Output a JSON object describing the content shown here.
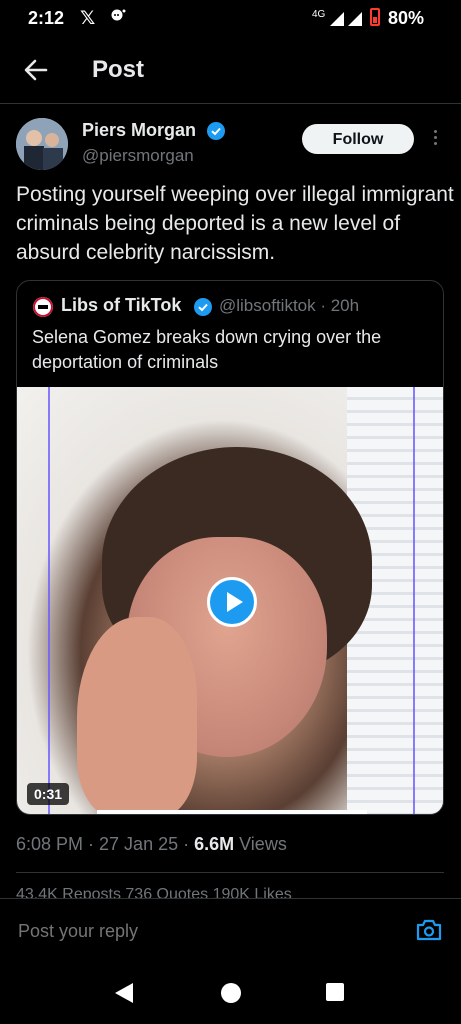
{
  "status_bar": {
    "time": "2:12",
    "x_logo": "𝕏",
    "network": "4G",
    "battery": "80%"
  },
  "header": {
    "title": "Post"
  },
  "post": {
    "author_name": "Piers Morgan",
    "author_handle": "@piersmorgan",
    "follow_label": "Follow",
    "text": "Posting yourself weeping over illegal immigrant criminals being deported is a new level of absurd celebrity narcissism.",
    "timestamp": "6:08 PM · 27 Jan 25 · ",
    "views_count": "6.6M",
    "views_label": " Views",
    "stats_cut": "43.4K Reposts   736 Quotes   190K Likes"
  },
  "quoted_post": {
    "author_name": "Libs of TikTok",
    "author_handle": "@libsoftiktok · 20h",
    "text": "Selena Gomez breaks down crying over the deportation of criminals",
    "video_duration": "0:31"
  },
  "reply": {
    "placeholder": "Post your reply"
  },
  "colors": {
    "background": "#000000",
    "accent": "#1d9bf0",
    "muted": "#71767b",
    "text": "#e7e9ea",
    "divider": "#2f3336"
  },
  "icons": [
    "back-arrow-icon",
    "verified-badge-icon",
    "more-options-icon",
    "play-icon",
    "camera-icon",
    "nav-back-icon",
    "nav-home-icon",
    "nav-recents-icon"
  ]
}
